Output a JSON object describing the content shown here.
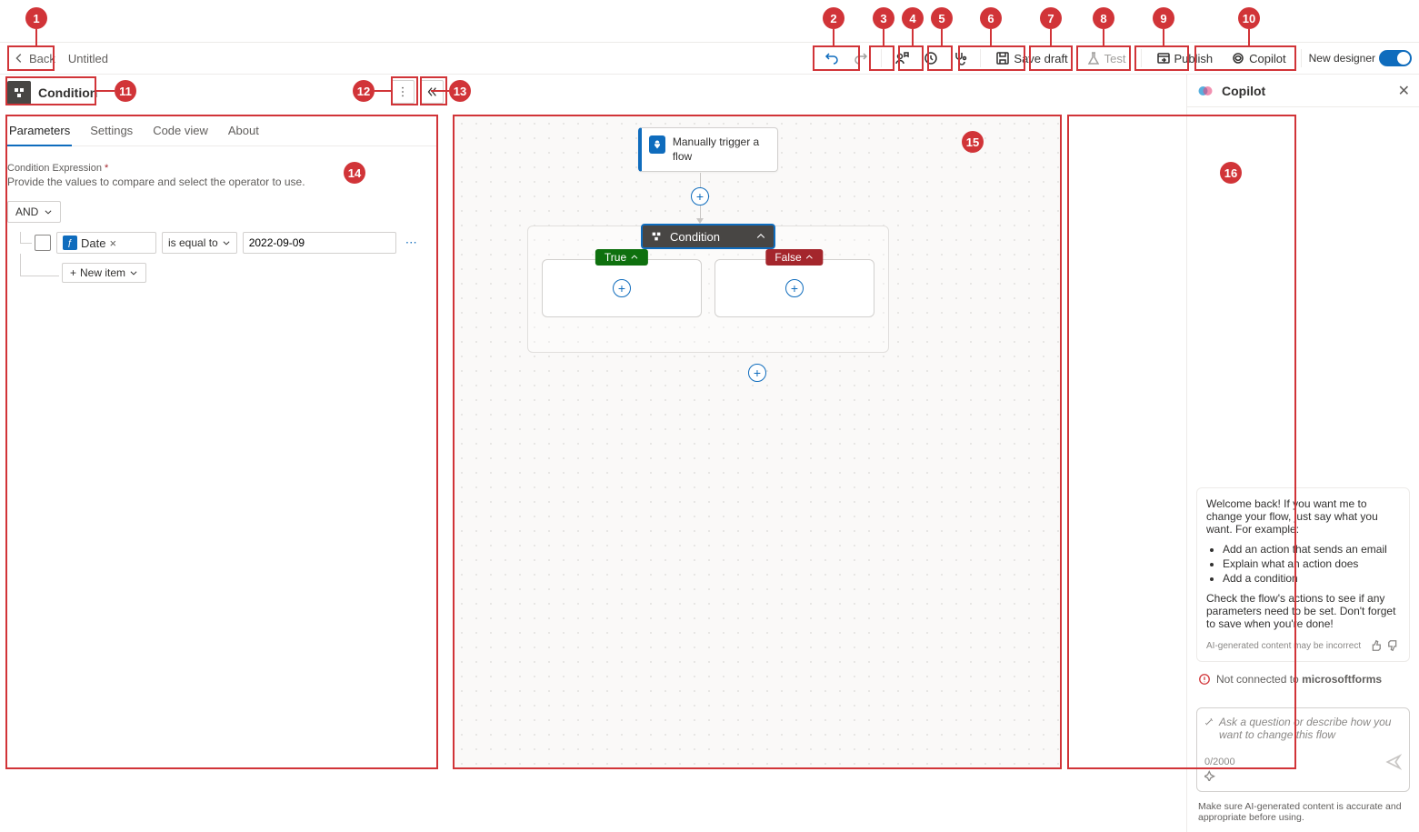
{
  "topbar": {
    "back": "Back",
    "title": "Untitled",
    "save_draft": "Save draft",
    "test": "Test",
    "publish": "Publish",
    "copilot": "Copilot",
    "new_designer": "New designer"
  },
  "panel": {
    "title": "Condition",
    "tabs": {
      "parameters": "Parameters",
      "settings": "Settings",
      "code_view": "Code view",
      "about": "About"
    },
    "field_label": "Condition Expression",
    "field_help": "Provide the values to compare and select the operator to use.",
    "logic_op": "AND",
    "row": {
      "token_icon": "fx",
      "token_label": "Date",
      "operator": "is equal to",
      "value": "2022-09-09"
    },
    "new_item": "New item"
  },
  "canvas": {
    "trigger": "Manually trigger a flow",
    "condition": "Condition",
    "true_label": "True",
    "false_label": "False"
  },
  "copilot": {
    "title": "Copilot",
    "welcome_1": "Welcome back! If you want me to change your flow, just say what you want. For example:",
    "bullets": [
      "Add an action that sends an email",
      "Explain what an action does",
      "Add a condition"
    ],
    "welcome_2": "Check the flow's actions to see if any parameters need to be set. Don't forget to save when you're done!",
    "disclaimer": "AI-generated content may be incorrect",
    "not_connected_pre": "Not connected to ",
    "not_connected_strong": "microsoftforms",
    "placeholder": "Ask a question or describe how you want to change this flow",
    "counter": "0/2000",
    "footer": "Make sure AI-generated content is accurate and appropriate before using."
  },
  "callouts": [
    "1",
    "2",
    "3",
    "4",
    "5",
    "6",
    "7",
    "8",
    "9",
    "10",
    "11",
    "12",
    "13",
    "14",
    "15",
    "16"
  ]
}
